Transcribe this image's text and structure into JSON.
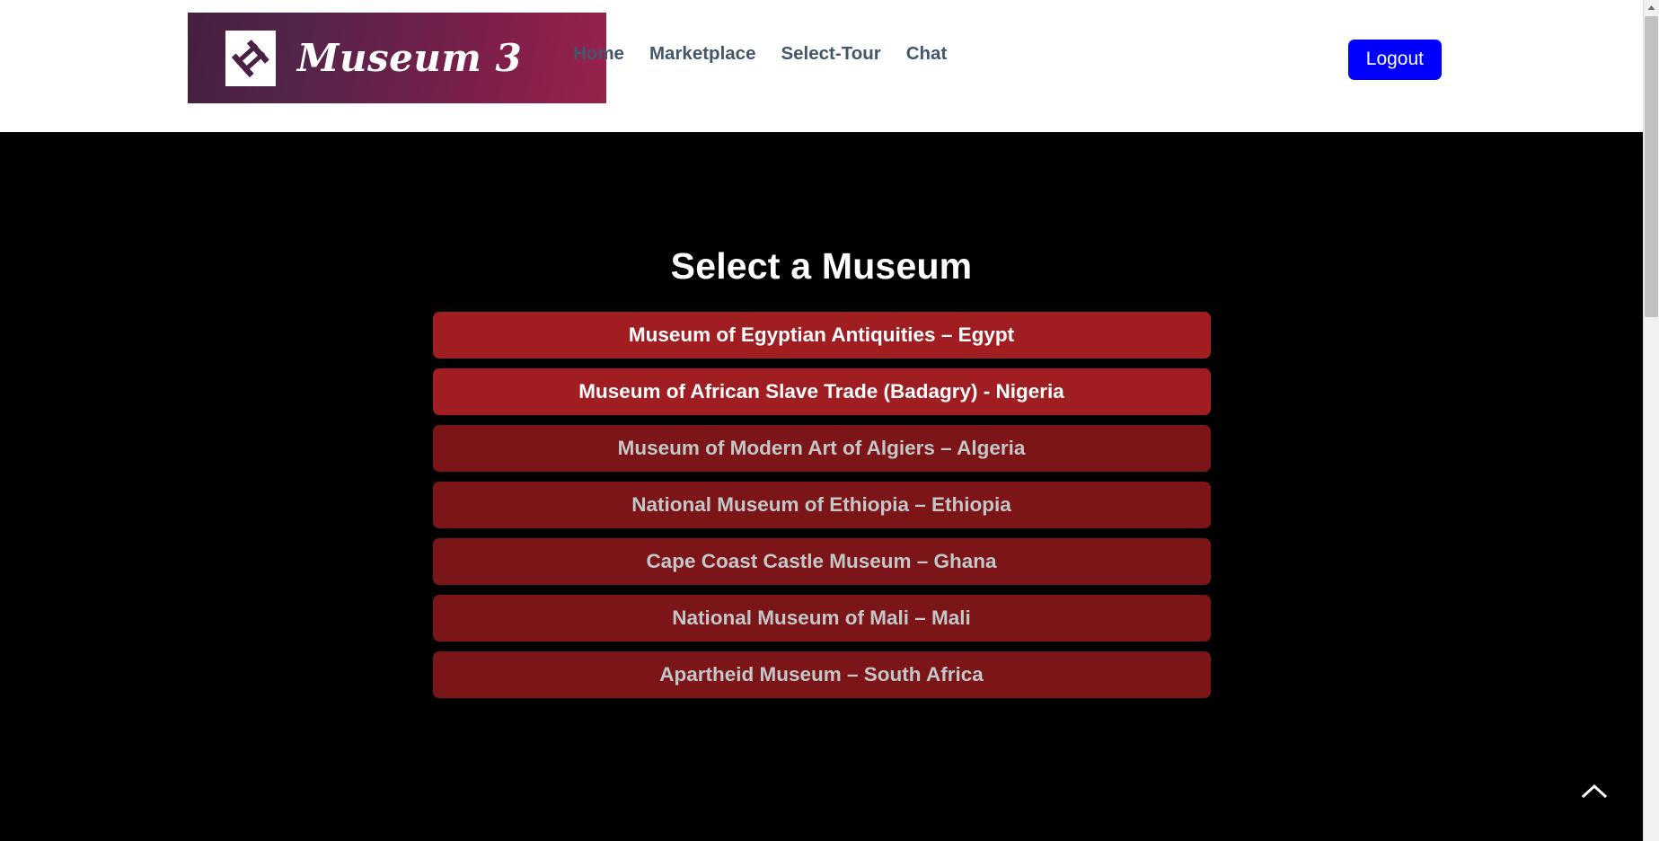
{
  "header": {
    "brand": {
      "icon": "museum-hash-logo-icon",
      "title": "Museum 3"
    },
    "nav_items": [
      {
        "label": "Home",
        "name": "nav-link-home"
      },
      {
        "label": "Marketplace",
        "name": "nav-link-marketplace"
      },
      {
        "label": "Select-Tour",
        "name": "nav-link-select-tour"
      },
      {
        "label": "Chat",
        "name": "nav-link-chat"
      }
    ],
    "logout_label": "Logout",
    "logout_color": "#0000ff"
  },
  "main": {
    "title": "Select a Museum",
    "museums": [
      {
        "label": "Museum of Egyptian Antiquities – Egypt",
        "state": "active"
      },
      {
        "label": "Museum of African Slave Trade (Badagry) - Nigeria",
        "state": "active"
      },
      {
        "label": "Museum of Modern Art of Algiers – Algeria",
        "state": "dim"
      },
      {
        "label": "National Museum of Ethiopia – Ethiopia",
        "state": "dim"
      },
      {
        "label": "Cape Coast Castle Museum – Ghana",
        "state": "dim"
      },
      {
        "label": "National Museum of Mali – Mali",
        "state": "dim"
      },
      {
        "label": "Apartheid Museum – South Africa",
        "state": "dim"
      }
    ],
    "button_colors": {
      "active_bg": "#a01e22",
      "active_text": "#ffffff",
      "dim_bg": "#7b1518",
      "dim_text": "#c3c7c8"
    }
  },
  "scroll_top": {
    "icon": "chevron-up-icon"
  },
  "scrollbar": {
    "up_arrow_icon": "scroll-up-arrow-icon"
  },
  "colors": {
    "page_background": "#000000",
    "header_background": "#ffffff",
    "brand_gradient_start": "#452040",
    "brand_gradient_end": "#98224c",
    "nav_text": "#44566c"
  }
}
